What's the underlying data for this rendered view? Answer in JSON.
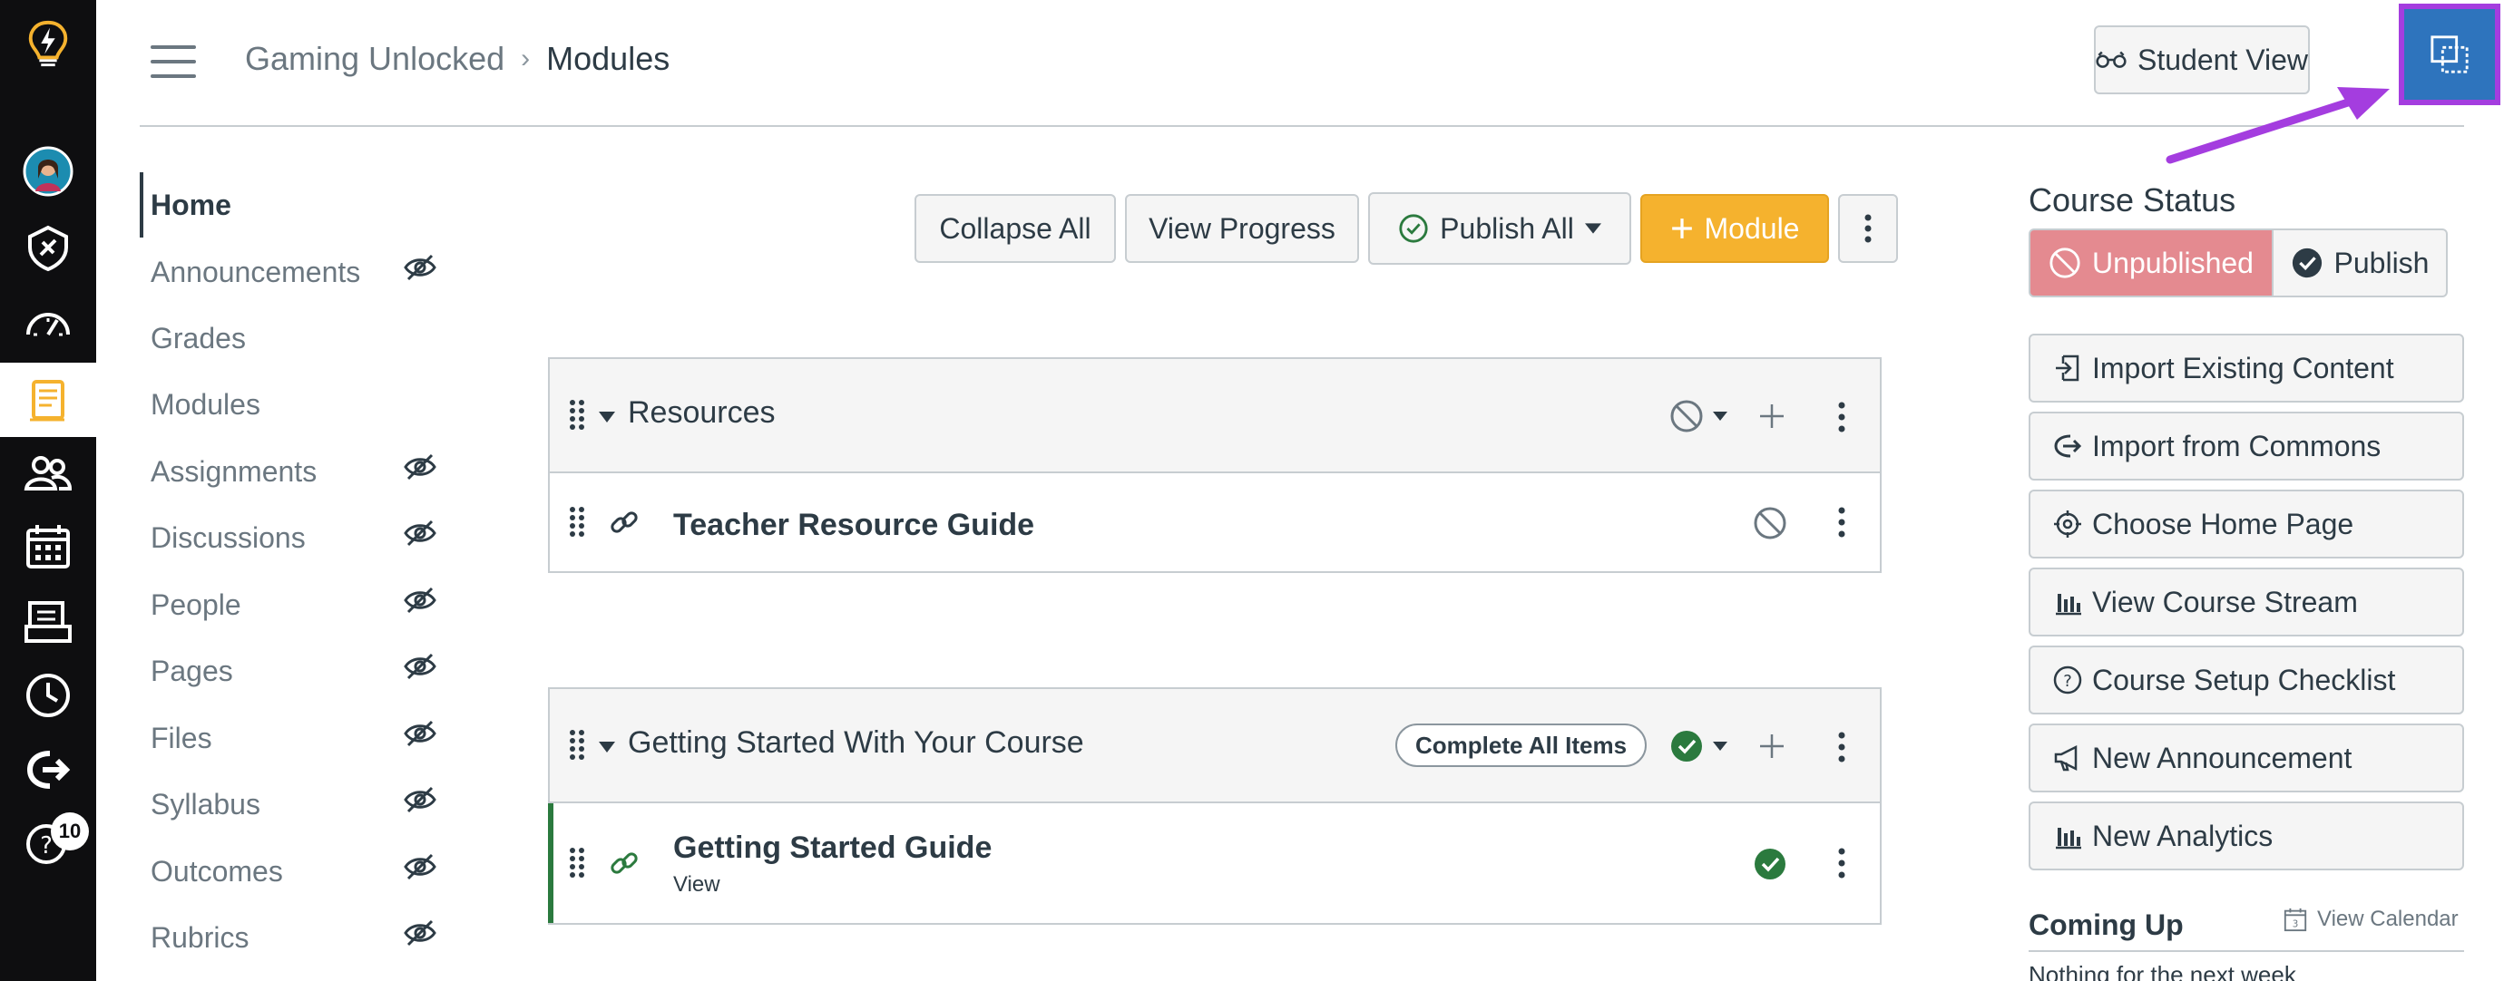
{
  "header": {
    "breadcrumb_course": "Gaming Unlocked",
    "breadcrumb_separator": "›",
    "breadcrumb_page": "Modules",
    "student_view_label": "Student View"
  },
  "global_nav": {
    "items": [
      "logo-icon",
      "account-avatar",
      "admin-icon",
      "dashboard-icon",
      "courses-icon",
      "groups-icon",
      "calendar-icon",
      "inbox-icon",
      "history-icon",
      "commons-icon",
      "help-icon"
    ],
    "help_badge": "10",
    "bg_color": "#0e0e10",
    "accent": "#f5b22e"
  },
  "course_nav": {
    "items": [
      {
        "label": "Home",
        "hidden": false,
        "active": true
      },
      {
        "label": "Announcements",
        "hidden": true
      },
      {
        "label": "Grades",
        "hidden": false
      },
      {
        "label": "Modules",
        "hidden": false
      },
      {
        "label": "Assignments",
        "hidden": true
      },
      {
        "label": "Discussions",
        "hidden": true
      },
      {
        "label": "People",
        "hidden": true
      },
      {
        "label": "Pages",
        "hidden": true
      },
      {
        "label": "Files",
        "hidden": true
      },
      {
        "label": "Syllabus",
        "hidden": true
      },
      {
        "label": "Outcomes",
        "hidden": true
      },
      {
        "label": "Rubrics",
        "hidden": true
      }
    ]
  },
  "toolbar": {
    "collapse_all": "Collapse All",
    "view_progress": "View Progress",
    "publish_all": "Publish All",
    "add_module": "Module"
  },
  "modules": [
    {
      "title": "Resources",
      "items": [
        {
          "title": "Teacher Resource Guide",
          "subtitle": "",
          "published": false
        }
      ]
    },
    {
      "title": "Getting Started With Your Course",
      "requirement": "Complete All Items",
      "items": [
        {
          "title": "Getting Started Guide",
          "subtitle": "View",
          "published": true
        }
      ]
    }
  ],
  "sidebar": {
    "course_status_heading": "Course Status",
    "unpublished": "Unpublished",
    "publish": "Publish",
    "actions": [
      "Import Existing Content",
      "Import from Commons",
      "Choose Home Page",
      "View Course Stream",
      "Course Setup Checklist",
      "New Announcement",
      "New Analytics"
    ],
    "coming_up": "Coming Up",
    "view_calendar": "View Calendar",
    "nothing_text": "Nothing for the next week"
  },
  "colors": {
    "published_green": "#2b7a3e",
    "unpublished_red": "#e48a90",
    "module_button": "#f5b22e",
    "highlight_purple": "#a43ddf",
    "toggle_blue": "#2e74bd"
  }
}
